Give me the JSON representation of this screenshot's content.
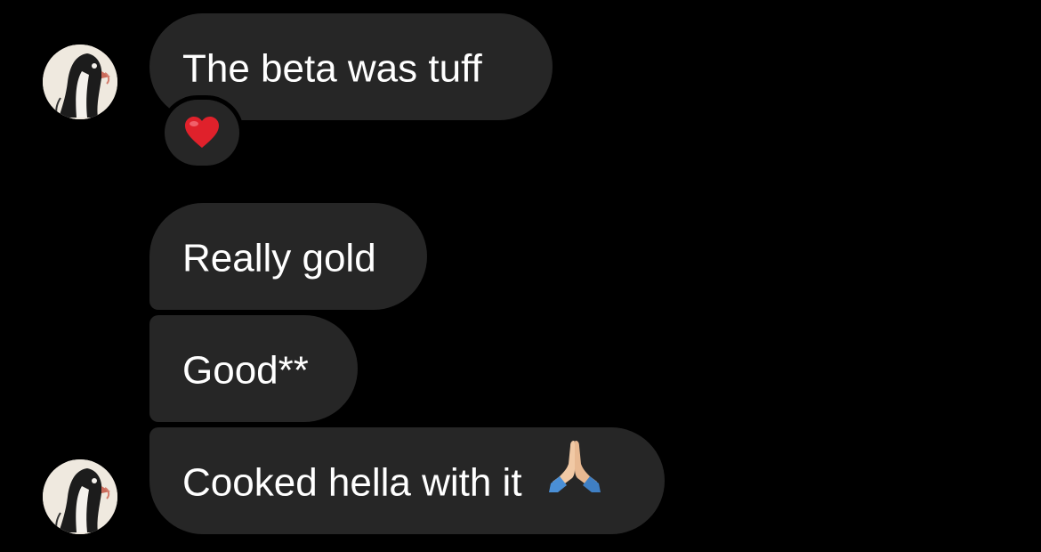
{
  "messages": [
    {
      "text": "The beta was tuff",
      "reaction": "red-heart"
    },
    {
      "text": "Really gold"
    },
    {
      "text": "Good**"
    },
    {
      "text": "Cooked hella with it",
      "emoji": "folded-hands"
    }
  ],
  "colors": {
    "background": "#000000",
    "bubble": "#262626",
    "text": "#ffffff",
    "heart": "#e0212b"
  }
}
